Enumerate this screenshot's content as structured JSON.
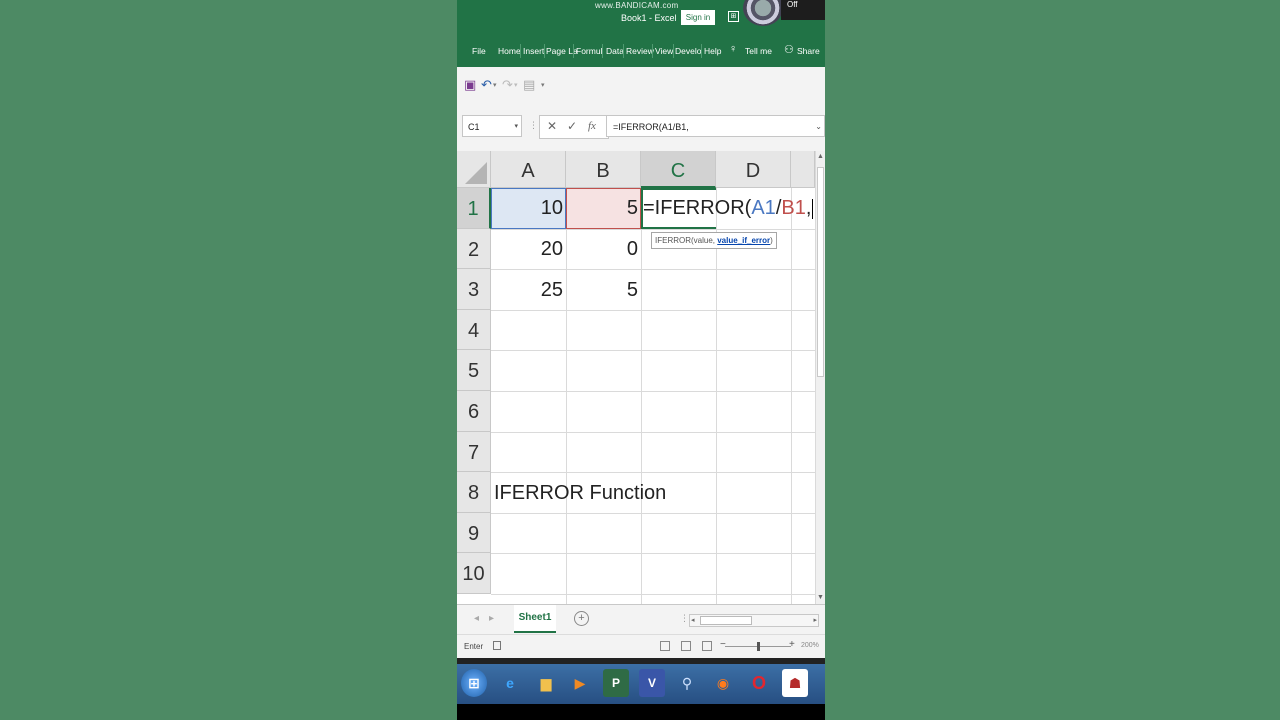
{
  "window": {
    "watermark": "www.BANDICAM.com",
    "title": "Book1  -  Excel",
    "sign_in": "Sign in",
    "recorder_label": "Off"
  },
  "ribbon": {
    "tabs": [
      "File",
      "Home",
      "Insert",
      "Page La",
      "Formul",
      "Data",
      "Review",
      "View",
      "Develo",
      "Help",
      "Tell me",
      "Share"
    ]
  },
  "formula_bar": {
    "name_box": "C1",
    "cancel": "✕",
    "enter": "✓",
    "fx": "fx",
    "content": "=IFERROR(A1/B1,"
  },
  "grid": {
    "columns": [
      "A",
      "B",
      "C",
      "D"
    ],
    "rows": [
      "1",
      "2",
      "3",
      "4",
      "5",
      "6",
      "7",
      "8",
      "9",
      "10"
    ],
    "cells": {
      "A1": "10",
      "B1": "5",
      "A2": "20",
      "B2": "0",
      "A3": "25",
      "B3": "5",
      "A8": "IFERROR Function"
    },
    "edit": {
      "prefix": "=IFERROR(",
      "ref_a": "A1",
      "slash": "/",
      "ref_b": "B1",
      "comma": ","
    },
    "tooltip": {
      "text": "IFERROR(value, ",
      "link": "value_if_error",
      "close": ")"
    }
  },
  "sheets": {
    "tabs": [
      "Sheet1"
    ],
    "add": "+"
  },
  "status": {
    "mode": "Enter",
    "zoom": "200%"
  },
  "colors": {
    "excel_green": "#217346",
    "ref_a": "#4a78c2",
    "ref_b": "#c0504d",
    "background": "#4d8a64"
  }
}
